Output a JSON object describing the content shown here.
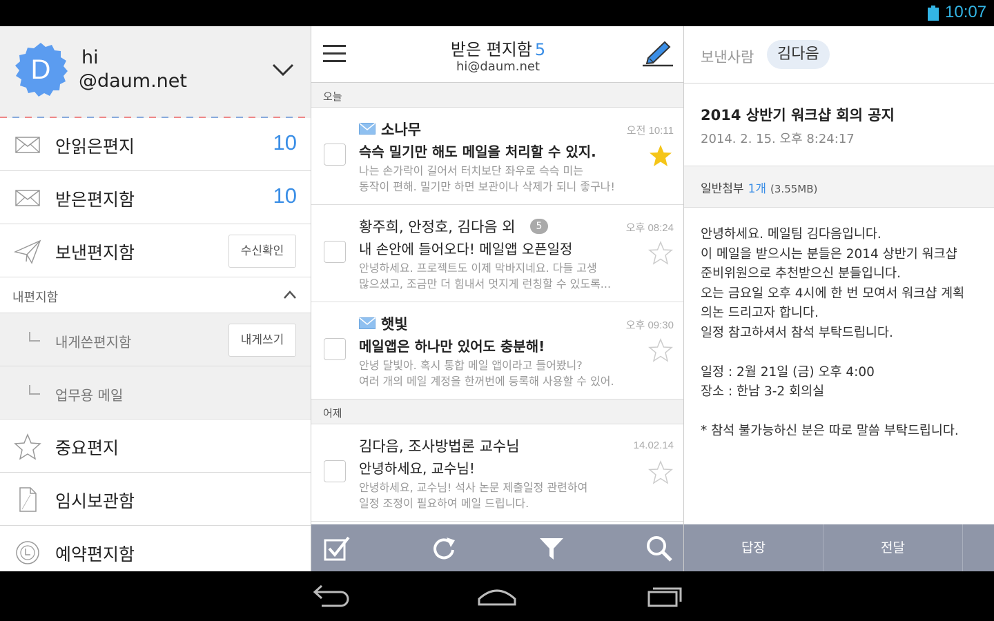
{
  "status_bar": {
    "time": "10:07"
  },
  "account": {
    "avatar_letter": "D",
    "name": "hi",
    "domain": "@daum.net"
  },
  "sidebar": {
    "unread": {
      "label": "안읽은편지",
      "count": "10"
    },
    "inbox": {
      "label": "받은편지함",
      "count": "10"
    },
    "sent": {
      "label": "보낸편지함",
      "button": "수신확인"
    },
    "my_folders": {
      "label": "내편지함"
    },
    "self_sent": {
      "label": "내게쓴편지함",
      "button": "내게쓰기"
    },
    "work_mail": {
      "label": "업무용 메일"
    },
    "starred": {
      "label": "중요편지"
    },
    "drafts": {
      "label": "임시보관함"
    },
    "scheduled": {
      "label": "예약편지함"
    }
  },
  "list": {
    "title": "받은 편지함",
    "count": "5",
    "account": "hi@daum.net",
    "section_today": "오늘",
    "section_yesterday": "어제",
    "mails": [
      {
        "sender": "소나무",
        "time": "오전 10:11",
        "subject": "슥슥 밀기만 해도 메일을 처리할 수 있지.",
        "preview1": "나는 손가락이 길어서 터치보단 좌우로 슥슥 미는",
        "preview2": "동작이 편해. 밀기만 하면 보관이나 삭제가 되니 좋구나!",
        "unread": true,
        "starred": true
      },
      {
        "sender": "황주희, 안정호, 김다음 외",
        "badge": "5",
        "time": "오후 08:24",
        "subject": "내 손안에 들어오다! 메일앱 오픈일정",
        "preview1": "안녕하세요. 프로젝트도 이제 막바지네요. 다들 고생",
        "preview2": "많으셨고, 조금만 더 힘내서 멋지게 런칭할 수 있도록...",
        "unread": false,
        "starred": false
      },
      {
        "sender": "햇빛",
        "time": "오후 09:30",
        "subject": "메일앱은 하나만 있어도 충분해!",
        "preview1": "안녕 달빛아. 혹시 통합 메일 앱이라고 들어봤니?",
        "preview2": "여러 개의 메일 계정을 한꺼번에 등록해 사용할 수 있어.",
        "unread": true,
        "starred": false
      },
      {
        "sender": "김다음, 조사방법론 교수님",
        "time": "14.02.14",
        "subject": "안녕하세요, 교수님!",
        "preview1": "안녕하세요, 교수님! 석사 논문 제출일정 관련하여",
        "preview2": "일정 조정이 필요하여 메일 드립니다.",
        "unread": false,
        "starred": false
      }
    ]
  },
  "reader": {
    "from_label": "보낸사람",
    "from_name": "김다음",
    "subject": "2014 상반기 워크샵 회의 공지",
    "date": "2014. 2. 15. 오후 8:24:17",
    "attach_label": "일반첨부",
    "attach_count": "1개",
    "attach_size": "(3.55MB)",
    "body": [
      "안녕하세요. 메일팀 김다음입니다.",
      "이 메일을 받으시는 분들은 2014 상반기 워크샵",
      "준비위원으로 추천받으신 분들입니다.",
      "오는 금요일 오후 4시에 한 번 모여서 워크샵 계획",
      "의논 드리고자 합니다.",
      "일정 참고하셔서 참석 부탁드립니다.",
      "",
      "일정 : 2월 21일 (금) 오후 4:00",
      "장소 : 한남 3-2 회의실",
      "",
      "* 참석 불가능하신 분은 따로 말씀 부탁드립니다."
    ],
    "reply": "답장",
    "forward": "전달"
  },
  "colors": {
    "accent": "#3a8ee6",
    "status": "#33b5e5",
    "toolbar": "#8f96a8",
    "avatar": "#5b9cf0",
    "star": "#f5c518"
  }
}
